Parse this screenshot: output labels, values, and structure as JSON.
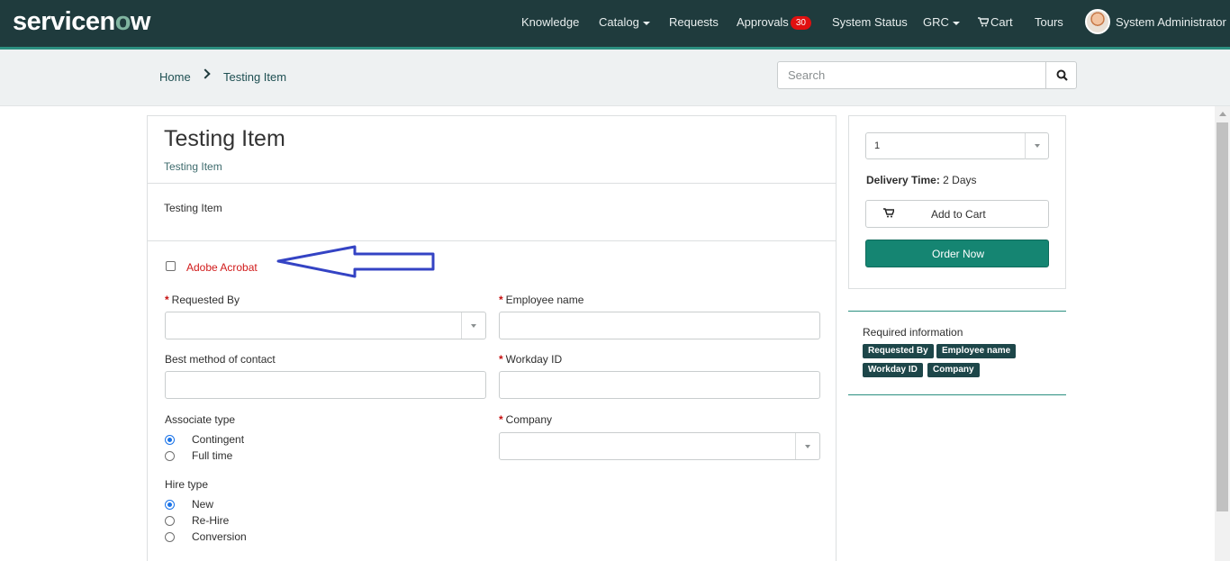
{
  "header": {
    "logo_main": "servicen",
    "logo_o": "o",
    "logo_end": "w",
    "nav": {
      "knowledge": "Knowledge",
      "catalog": "Catalog",
      "requests": "Requests",
      "approvals": "Approvals",
      "approvals_count": "30",
      "system_status": "System Status",
      "grc": "GRC",
      "cart": "Cart",
      "tours": "Tours",
      "user": "System Administrator"
    }
  },
  "breadcrumb": {
    "home": "Home",
    "current": "Testing Item"
  },
  "search": {
    "placeholder": "Search"
  },
  "item": {
    "title": "Testing Item",
    "short_description": "Testing Item",
    "description": "Testing Item"
  },
  "form": {
    "adobe_checkbox_label": "Adobe Acrobat",
    "requested_by_label": "Requested By",
    "employee_name_label": "Employee name",
    "best_contact_label": "Best method of contact",
    "workday_id_label": "Workday ID",
    "associate_type_label": "Associate type",
    "associate_options": [
      "Contingent",
      "Full time"
    ],
    "company_label": "Company",
    "hire_type_label": "Hire type",
    "hire_options": [
      "New",
      "Re-Hire",
      "Conversion"
    ]
  },
  "order_panel": {
    "quantity": "1",
    "delivery_label": "Delivery Time:",
    "delivery_value": "2 Days",
    "add_to_cart": "Add to Cart",
    "order_now": "Order Now"
  },
  "required_info": {
    "title": "Required information",
    "chips": [
      "Requested By",
      "Employee name",
      "Workday ID",
      "Company"
    ]
  },
  "colors": {
    "nav_bg": "#1f3b3d",
    "accent": "#158572",
    "required_star": "#c61010",
    "annotation_arrow": "#3443c4"
  }
}
